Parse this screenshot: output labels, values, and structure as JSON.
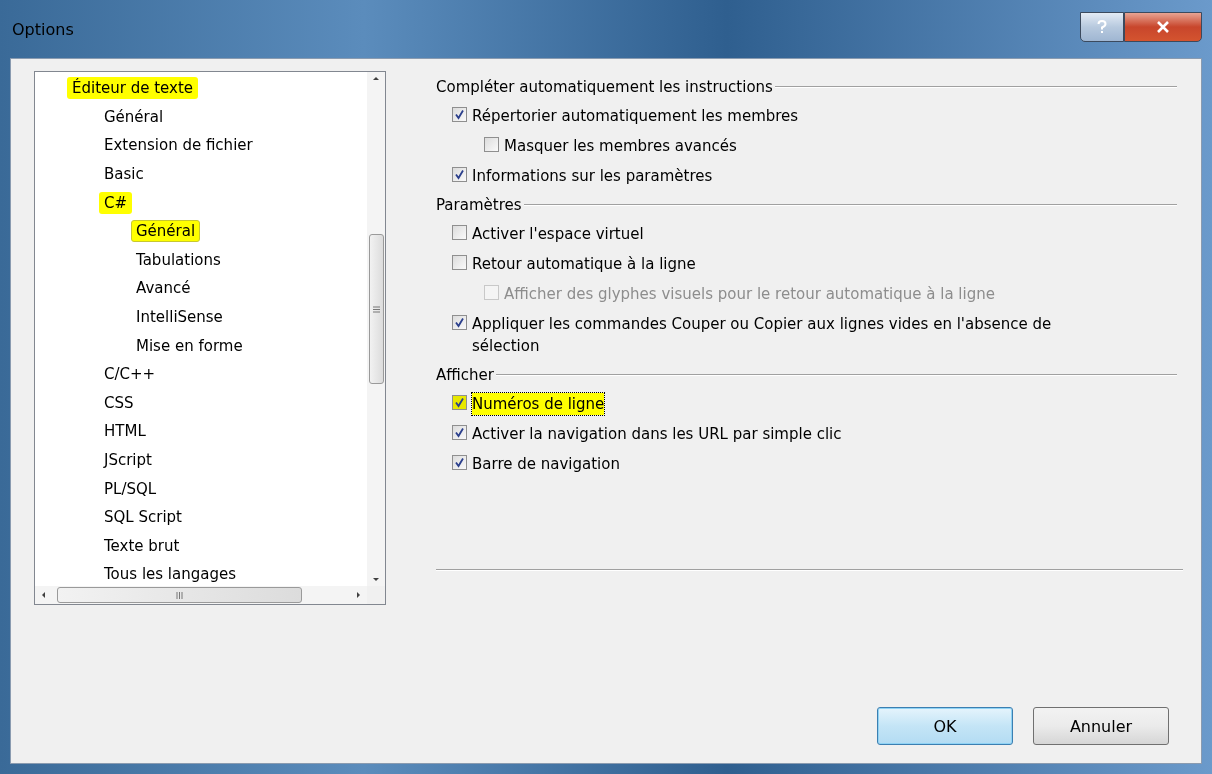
{
  "window": {
    "title": "Options"
  },
  "tree": [
    {
      "label": "Éditeur de texte",
      "highlighted": true,
      "selected": false,
      "children": [
        {
          "label": "Général",
          "highlighted": false,
          "selected": false
        },
        {
          "label": "Extension de fichier",
          "highlighted": false,
          "selected": false
        },
        {
          "label": "Basic",
          "highlighted": false,
          "selected": false
        },
        {
          "label": "C#",
          "highlighted": true,
          "selected": false,
          "children": [
            {
              "label": "Général",
              "highlighted": true,
              "selected": true
            },
            {
              "label": "Tabulations",
              "highlighted": false,
              "selected": false
            },
            {
              "label": "Avancé",
              "highlighted": false,
              "selected": false
            },
            {
              "label": "IntelliSense",
              "highlighted": false,
              "selected": false
            },
            {
              "label": "Mise en forme",
              "highlighted": false,
              "selected": false
            }
          ]
        },
        {
          "label": "C/C++",
          "highlighted": false,
          "selected": false
        },
        {
          "label": "CSS",
          "highlighted": false,
          "selected": false
        },
        {
          "label": "HTML",
          "highlighted": false,
          "selected": false
        },
        {
          "label": "JScript",
          "highlighted": false,
          "selected": false
        },
        {
          "label": "PL/SQL",
          "highlighted": false,
          "selected": false
        },
        {
          "label": "SQL Script",
          "highlighted": false,
          "selected": false
        },
        {
          "label": "Texte brut",
          "highlighted": false,
          "selected": false
        },
        {
          "label": "Tous les langages",
          "highlighted": false,
          "selected": false
        }
      ]
    }
  ],
  "groups": [
    {
      "title": "Compléter automatiquement les instructions",
      "options": [
        {
          "label": "Répertorier automatiquement les membres",
          "checked": true,
          "disabled": false,
          "highlighted": false,
          "children": [
            {
              "label": "Masquer les membres avancés",
              "checked": false,
              "disabled": false,
              "highlighted": false
            }
          ]
        },
        {
          "label": "Informations sur les paramètres",
          "checked": true,
          "disabled": false,
          "highlighted": false
        }
      ]
    },
    {
      "title": "Paramètres",
      "options": [
        {
          "label": "Activer l'espace virtuel",
          "checked": false,
          "disabled": false,
          "highlighted": false
        },
        {
          "label": "Retour automatique à la ligne",
          "checked": false,
          "disabled": false,
          "highlighted": false,
          "children": [
            {
              "label": "Afficher des glyphes visuels pour le retour automatique à la ligne",
              "checked": false,
              "disabled": true,
              "highlighted": false
            }
          ]
        },
        {
          "label": "Appliquer les commandes Couper ou Copier aux lignes vides en l'absence de sélection",
          "checked": true,
          "disabled": false,
          "highlighted": false
        }
      ]
    },
    {
      "title": "Afficher",
      "options": [
        {
          "label": "Numéros de ligne",
          "checked": true,
          "disabled": false,
          "highlighted": true
        },
        {
          "label": "Activer la navigation dans les URL par simple clic",
          "checked": true,
          "disabled": false,
          "highlighted": false
        },
        {
          "label": "Barre de navigation",
          "checked": true,
          "disabled": false,
          "highlighted": false
        }
      ]
    }
  ],
  "buttons": [
    {
      "label": "OK",
      "default": true
    },
    {
      "label": "Annuler",
      "default": false
    }
  ]
}
